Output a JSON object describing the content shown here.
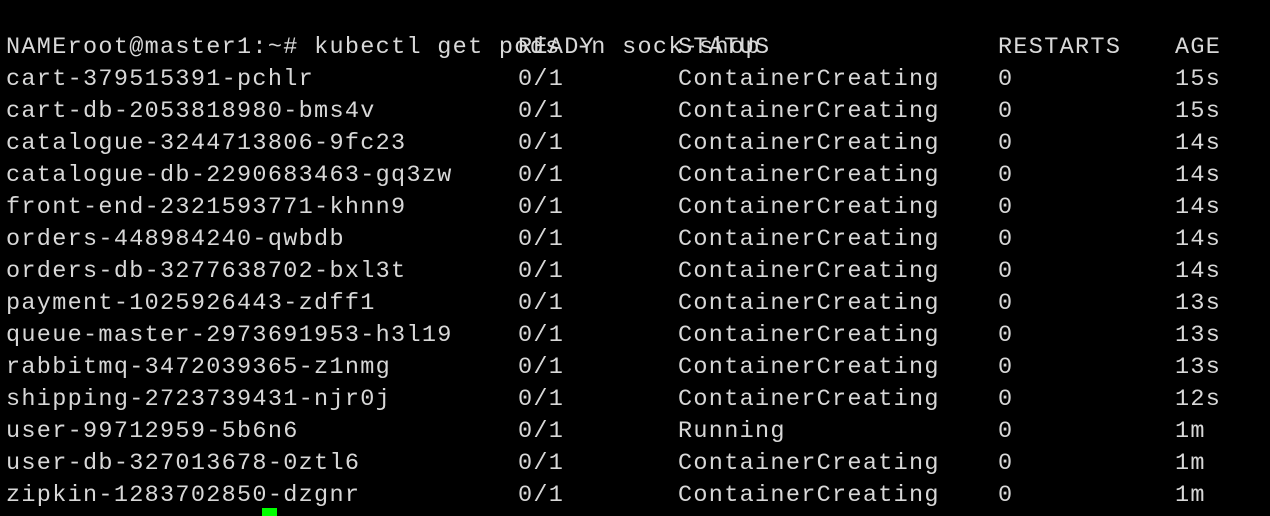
{
  "terminal": {
    "prompt": "root@master1:~#",
    "command": "kubectl get pods -n sock-shop",
    "headers": {
      "name": "NAME",
      "ready": "READY",
      "status": "STATUS",
      "restarts": "RESTARTS",
      "age": "AGE"
    },
    "rows": [
      {
        "name": "cart-379515391-pchlr",
        "ready": "0/1",
        "status": "ContainerCreating",
        "restarts": "0",
        "age": "15s"
      },
      {
        "name": "cart-db-2053818980-bms4v",
        "ready": "0/1",
        "status": "ContainerCreating",
        "restarts": "0",
        "age": "15s"
      },
      {
        "name": "catalogue-3244713806-9fc23",
        "ready": "0/1",
        "status": "ContainerCreating",
        "restarts": "0",
        "age": "14s"
      },
      {
        "name": "catalogue-db-2290683463-gq3zw",
        "ready": "0/1",
        "status": "ContainerCreating",
        "restarts": "0",
        "age": "14s"
      },
      {
        "name": "front-end-2321593771-khnn9",
        "ready": "0/1",
        "status": "ContainerCreating",
        "restarts": "0",
        "age": "14s"
      },
      {
        "name": "orders-448984240-qwbdb",
        "ready": "0/1",
        "status": "ContainerCreating",
        "restarts": "0",
        "age": "14s"
      },
      {
        "name": "orders-db-3277638702-bxl3t",
        "ready": "0/1",
        "status": "ContainerCreating",
        "restarts": "0",
        "age": "14s"
      },
      {
        "name": "payment-1025926443-zdff1",
        "ready": "0/1",
        "status": "ContainerCreating",
        "restarts": "0",
        "age": "13s"
      },
      {
        "name": "queue-master-2973691953-h3l19",
        "ready": "0/1",
        "status": "ContainerCreating",
        "restarts": "0",
        "age": "13s"
      },
      {
        "name": "rabbitmq-3472039365-z1nmg",
        "ready": "0/1",
        "status": "ContainerCreating",
        "restarts": "0",
        "age": "13s"
      },
      {
        "name": "shipping-2723739431-njr0j",
        "ready": "0/1",
        "status": "ContainerCreating",
        "restarts": "0",
        "age": "12s"
      },
      {
        "name": "user-99712959-5b6n6",
        "ready": "0/1",
        "status": "Running",
        "restarts": "0",
        "age": "1m"
      },
      {
        "name": "user-db-327013678-0ztl6",
        "ready": "0/1",
        "status": "ContainerCreating",
        "restarts": "0",
        "age": "1m"
      },
      {
        "name": "zipkin-1283702850-dzgnr",
        "ready": "0/1",
        "status": "ContainerCreating",
        "restarts": "0",
        "age": "1m"
      }
    ]
  },
  "colors": {
    "background": "#000000",
    "text": "#d8d8d8",
    "cursor": "#00ff00"
  }
}
